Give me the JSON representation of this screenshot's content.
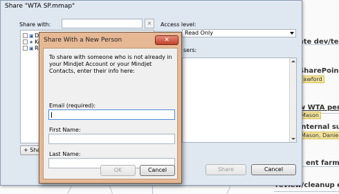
{
  "background": {
    "nodes": [
      {
        "text": "ate dev/tes"
      },
      {
        "text": "SharePoin"
      },
      {
        "text": "w WTA per"
      },
      {
        "text": "internal su"
      },
      {
        "text": "ent farm co"
      },
      {
        "text": "review/cleanup ex"
      }
    ],
    "tags": [
      {
        "text": "rawford"
      },
      {
        "text": "Mason"
      },
      {
        "text": "Mason, Daniel"
      }
    ]
  },
  "share_window": {
    "title": "Share \"WTA SP.mmap\"",
    "share_with_label": "Share with:",
    "share_with_value": "",
    "clear_label": "×",
    "access_level_label": "Access level:",
    "access_level_value": "Read Only",
    "users_label": "sers:",
    "tree_items": [
      {
        "label": "De"
      },
      {
        "label": "Ke"
      },
      {
        "label": "Re"
      }
    ],
    "add_button_label": "+  Sha",
    "share_button_label": "Share",
    "cancel_button_label": "Cancel"
  },
  "modal": {
    "title": "Share With a New Person",
    "close_label": "✕",
    "description": "To share with someone who is not already in your Mindjet Account or your Mindjet Contacts, enter their info here:",
    "email_label": "Email (required):",
    "email_value": "",
    "first_name_label": "First Name:",
    "first_name_value": "",
    "last_name_label": "Last Name:",
    "last_name_value": "",
    "ok_label": "OK",
    "cancel_label": "Cancel"
  },
  "colors": {
    "modal_frame": "#e6b894",
    "window_frame": "#dfe7f1",
    "close_button": "#c2402a",
    "tag_background": "#f3e39b"
  }
}
